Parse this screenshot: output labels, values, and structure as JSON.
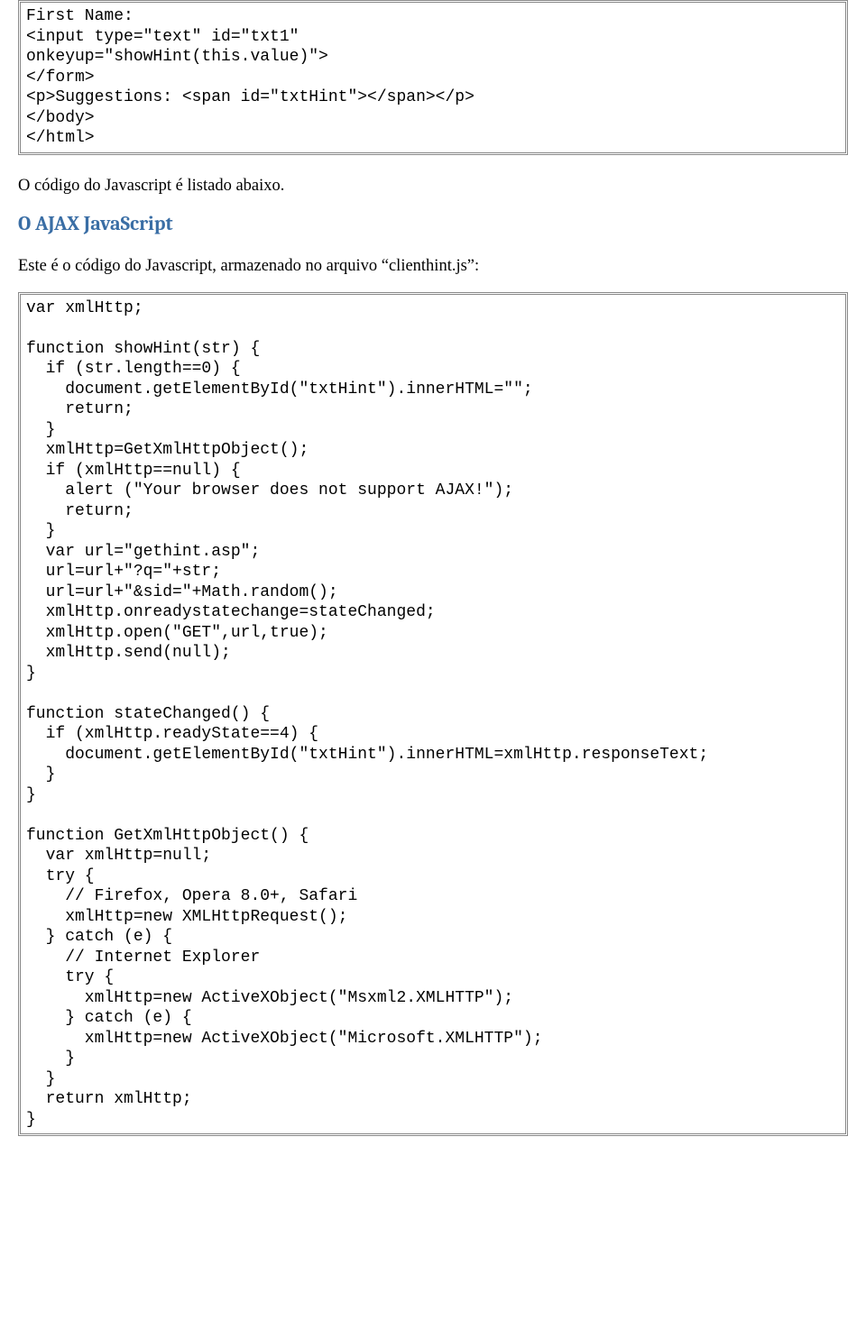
{
  "codeBox1": "First Name:\n<input type=\"text\" id=\"txt1\"\nonkeyup=\"showHint(this.value)\">\n</form>\n<p>Suggestions: <span id=\"txtHint\"></span></p>\n</body>\n</html>",
  "para1": "O código do Javascript é listado abaixo.",
  "heading1": "O AJAX JavaScript",
  "para2": "Este é o código do Javascript, armazenado no arquivo “clienthint.js”:",
  "codeBox2": "var xmlHttp;\n\nfunction showHint(str) {\n  if (str.length==0) {\n    document.getElementById(\"txtHint\").innerHTML=\"\";\n    return;\n  }\n  xmlHttp=GetXmlHttpObject();\n  if (xmlHttp==null) {\n    alert (\"Your browser does not support AJAX!\");\n    return;\n  }\n  var url=\"gethint.asp\";\n  url=url+\"?q=\"+str;\n  url=url+\"&sid=\"+Math.random();\n  xmlHttp.onreadystatechange=stateChanged;\n  xmlHttp.open(\"GET\",url,true);\n  xmlHttp.send(null);\n}\n\nfunction stateChanged() {\n  if (xmlHttp.readyState==4) {\n    document.getElementById(\"txtHint\").innerHTML=xmlHttp.responseText;\n  }\n}\n\nfunction GetXmlHttpObject() {\n  var xmlHttp=null;\n  try {\n    // Firefox, Opera 8.0+, Safari\n    xmlHttp=new XMLHttpRequest();\n  } catch (e) {\n    // Internet Explorer\n    try {\n      xmlHttp=new ActiveXObject(\"Msxml2.XMLHTTP\");\n    } catch (e) {\n      xmlHttp=new ActiveXObject(\"Microsoft.XMLHTTP\");\n    }\n  }\n  return xmlHttp;\n}"
}
